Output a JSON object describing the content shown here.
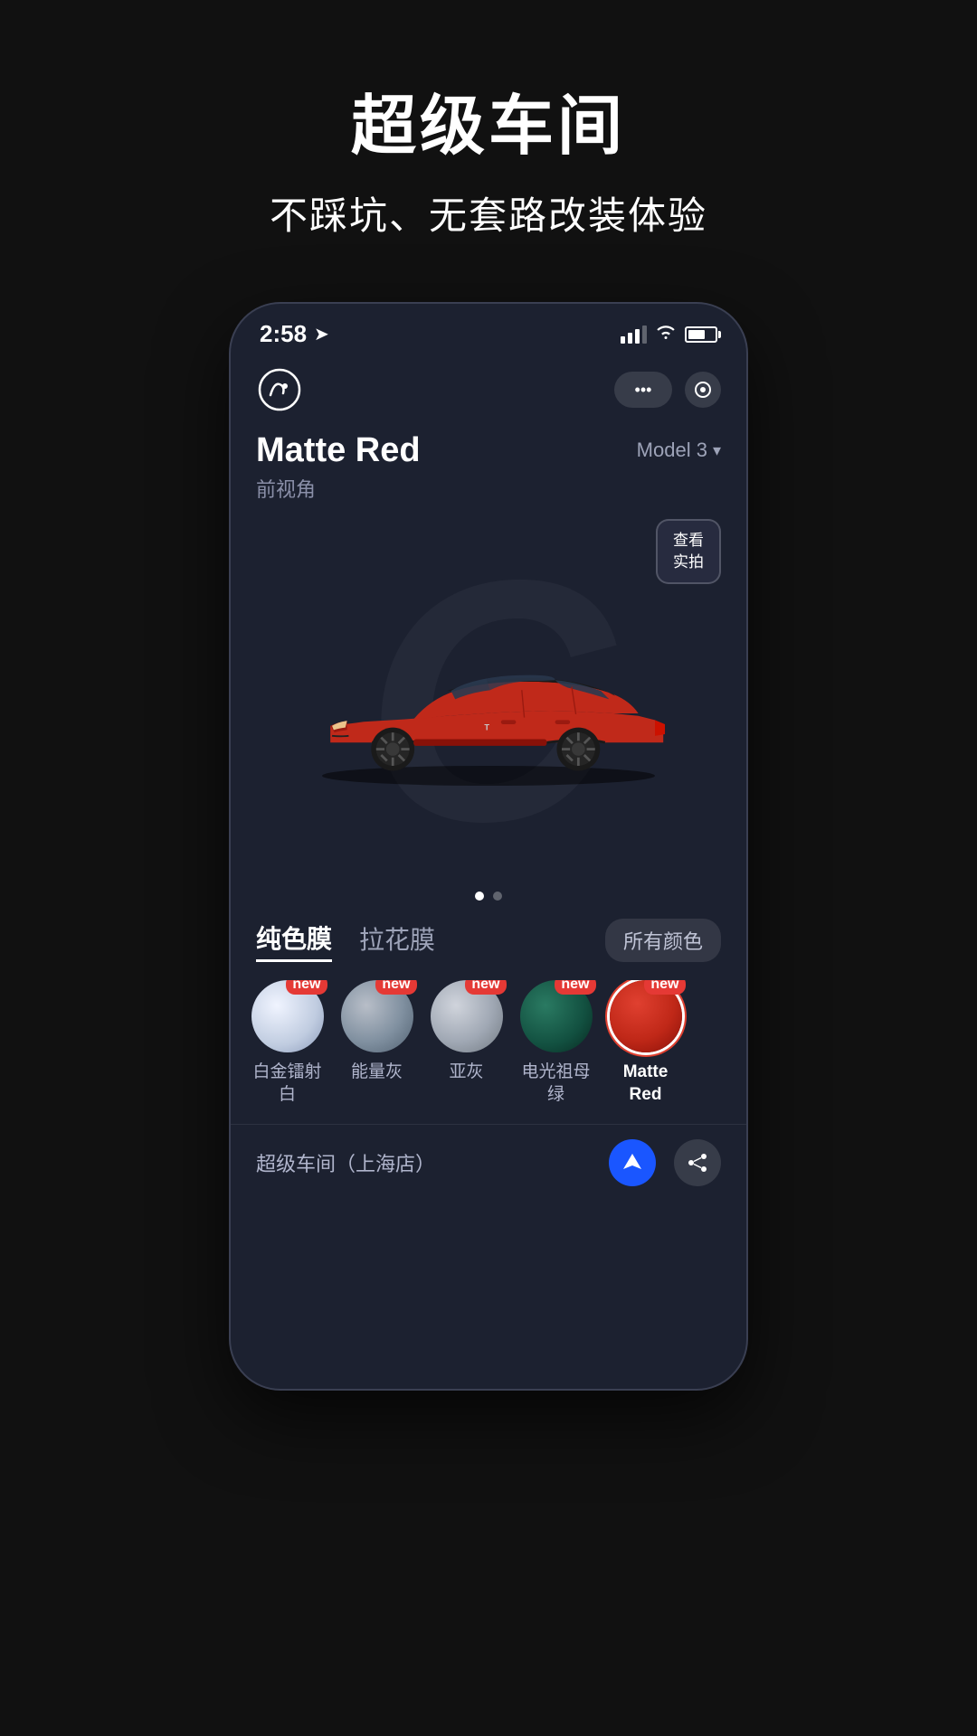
{
  "page": {
    "background": "#111111",
    "title": "超级车间",
    "subtitle": "不踩坑、无套路改装体验"
  },
  "status_bar": {
    "time": "2:58",
    "signal": "signal-icon",
    "wifi": "wifi-icon",
    "battery": "battery-icon"
  },
  "app_header": {
    "logo_alt": "app-logo",
    "more_btn": "•••",
    "record_btn": "⊙"
  },
  "car_info": {
    "name": "Matte Red",
    "angle": "前视角",
    "model": "Model 3",
    "real_shot_btn": "查看\n实拍"
  },
  "film_tabs": {
    "active": "纯色膜",
    "inactive": "拉花膜",
    "all_colors_btn": "所有颜色"
  },
  "color_swatches": [
    {
      "label": "白金镭射白",
      "color_start": "#e8eef8",
      "color_end": "#c8d8f0",
      "is_new": true,
      "is_active": false
    },
    {
      "label": "能量灰",
      "color_start": "#9aa0b0",
      "color_end": "#6a7080",
      "is_new": true,
      "is_active": false
    },
    {
      "label": "亚灰",
      "color_start": "#b8bec8",
      "color_end": "#9098a8",
      "is_new": true,
      "is_active": false
    },
    {
      "label": "电光祖母绿",
      "color_start": "#1a5a4a",
      "color_end": "#0d3830",
      "is_new": true,
      "is_active": false
    },
    {
      "label": "Matte Red",
      "color_start": "#cc3322",
      "color_end": "#991a10",
      "is_new": true,
      "is_active": true
    }
  ],
  "pagination": {
    "active_index": 0,
    "total": 2
  },
  "bottom_bar": {
    "shop_name": "超级车间（上海店）"
  }
}
